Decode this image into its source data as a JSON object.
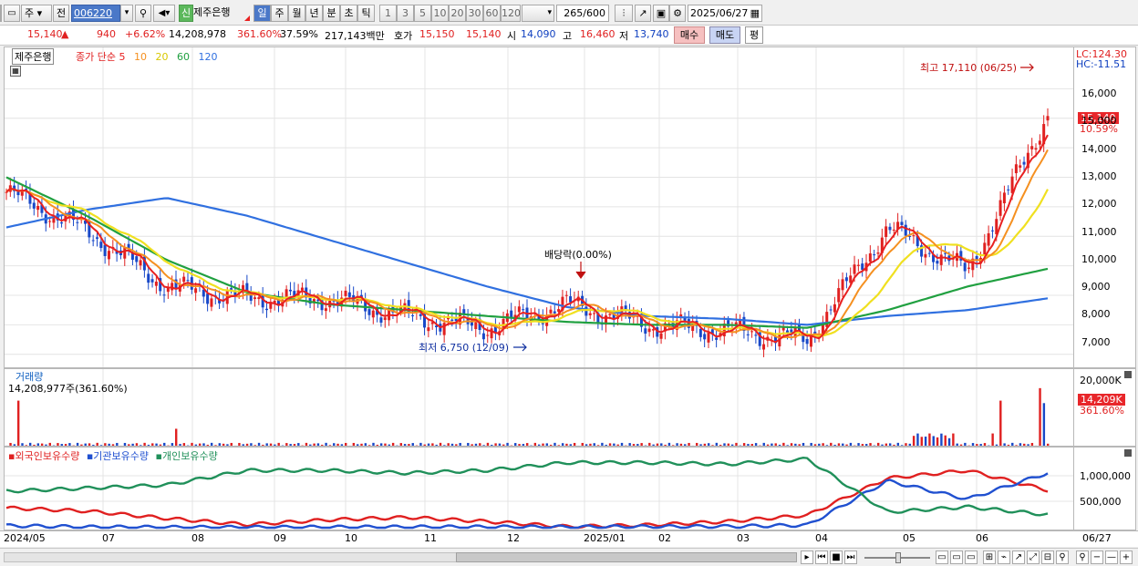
{
  "toolbar": {
    "market_label": "주",
    "ref_label": "전",
    "stock_code": "006220",
    "new_badge": "신",
    "stock_name": "제주은행",
    "periods": [
      "일",
      "주",
      "월",
      "년",
      "분",
      "초",
      "틱"
    ],
    "active_period": "일",
    "intervals": [
      "1",
      "3",
      "5",
      "10",
      "20",
      "30",
      "60",
      "120"
    ],
    "count": "265",
    "count_total": "/600",
    "date": "2025/06/27"
  },
  "info": {
    "price": "15,140",
    "arrow": "▲",
    "change": "940",
    "change_pct": "+6.62%",
    "volume": "14,208,978",
    "vol_ratio": "361.60%",
    "turnover": "37.59%",
    "amount": "217,143백만",
    "bid_label": "호가",
    "ask": "15,150",
    "bid": "15,140",
    "open_label": "시",
    "open": "14,090",
    "high_label": "고",
    "high": "16,460",
    "low_label": "저",
    "low": "13,740",
    "buy_label": "매수",
    "sell_label": "매도",
    "eval_label": "평"
  },
  "legend": {
    "stock": "제주은행",
    "ma_prefix": "종가 단순",
    "ma": [
      {
        "period": "5",
        "color": "#e82020"
      },
      {
        "period": "10",
        "color": "#f59020"
      },
      {
        "period": "20",
        "color": "#f0e020"
      },
      {
        "period": "60",
        "color": "#20a040"
      },
      {
        "period": "120",
        "color": "#3070e0"
      }
    ]
  },
  "annotations": {
    "high": "최고 17,110 (06/25)",
    "low": "최저 6,750 (12/09)",
    "dividend": "배당락(0.00%)"
  },
  "price_axis": {
    "lc": "LC:124.30",
    "hc": "HC:-11.51",
    "ticks": [
      "16,000",
      "15,000",
      "14,000",
      "13,000",
      "12,000",
      "11,000",
      "10,000",
      "9,000",
      "8,000",
      "7,000"
    ],
    "current": "15,140",
    "current_pct": "10.59%"
  },
  "volume_panel": {
    "title": "거래량",
    "value": "14,208,977주(361.60%)",
    "ticks": [
      "20,000K"
    ],
    "current": "14,209K",
    "current_pct": "361.60%"
  },
  "holdings_panel": {
    "series": [
      {
        "name": "외국인보유수량",
        "color": "#e02020"
      },
      {
        "name": "기관보유수량",
        "color": "#2050d0"
      },
      {
        "name": "개인보유수량",
        "color": "#20905a"
      }
    ],
    "ticks": [
      "1,000,000",
      "500,000"
    ]
  },
  "x_axis": {
    "labels": [
      "2024/05",
      "07",
      "08",
      "09",
      "10",
      "11",
      "12",
      "2025/01",
      "02",
      "03",
      "04",
      "05",
      "06"
    ],
    "end_label": "06/27"
  },
  "chart_data": [
    {
      "type": "candlestick",
      "title": "제주은행",
      "ylim": [
        6500,
        17400
      ],
      "series_ma": [
        "5",
        "10",
        "20",
        "60",
        "120"
      ],
      "x": [
        "2024/05",
        "07",
        "08",
        "09",
        "10",
        "11",
        "12",
        "2025/01",
        "02",
        "03",
        "04",
        "05",
        "06",
        "06/27"
      ],
      "close": [
        12500,
        11200,
        9300,
        8900,
        8900,
        8300,
        7900,
        8700,
        8000,
        7800,
        7500,
        11300,
        9800,
        15140
      ],
      "ma60": [
        13000,
        11700,
        10200,
        9100,
        8700,
        8500,
        8300,
        8100,
        8000,
        8000,
        7900,
        8500,
        9300,
        9900
      ],
      "ma120": [
        11300,
        11900,
        12300,
        11700,
        10900,
        10100,
        9300,
        8600,
        8300,
        8200,
        8000,
        8300,
        8500,
        8900
      ],
      "high_value": 17110,
      "low_value": 6750
    },
    {
      "type": "bar",
      "title": "거래량",
      "ylim": [
        0,
        21000
      ],
      "unit": "K",
      "last": 14209
    },
    {
      "type": "line",
      "ylim": [
        0,
        1400000
      ],
      "series": [
        {
          "name": "외국인보유수량",
          "values": [
            380000,
            320000,
            180000,
            60000,
            150000,
            200000,
            120000,
            20000,
            50000,
            120000,
            240000,
            950000,
            1100000,
            720000
          ]
        },
        {
          "name": "기관보유수량",
          "values": [
            40000,
            15000,
            10000,
            10000,
            12000,
            15000,
            15000,
            15000,
            20000,
            25000,
            50000,
            900000,
            550000,
            1050000
          ]
        },
        {
          "name": "개인보유수량",
          "values": [
            700000,
            760000,
            820000,
            1100000,
            1100000,
            1050000,
            1100000,
            1250000,
            1250000,
            1220000,
            1320000,
            300000,
            400000,
            250000
          ]
        }
      ]
    }
  ]
}
